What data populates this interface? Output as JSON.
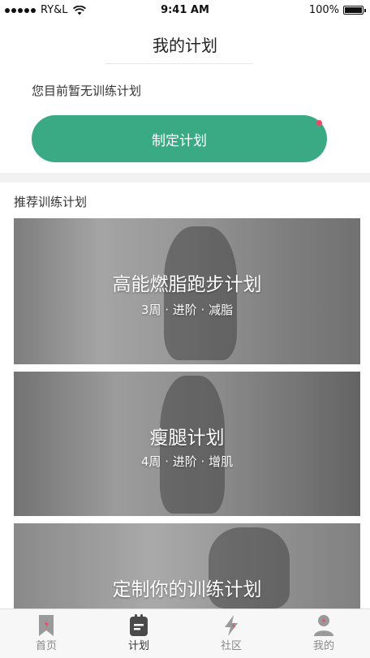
{
  "status_bar": {
    "carrier": "RY&L",
    "time": "9:41 AM",
    "battery": "100%"
  },
  "nav": {
    "title": "我的计划"
  },
  "plan": {
    "empty_text": "您目前暂无训练计划",
    "make_button": "制定计划"
  },
  "recommend": {
    "section_title": "推荐训练计划",
    "cards": [
      {
        "title": "高能燃脂跑步计划",
        "meta": "3周 · 进阶 · 减脂"
      },
      {
        "title": "瘦腿计划",
        "meta": "4周 · 进阶 · 增肌"
      },
      {
        "title": "定制你的训练计划",
        "meta": ""
      }
    ]
  },
  "tabbar": {
    "tabs": [
      {
        "label": "首页",
        "icon": "bookmark-icon",
        "active": false
      },
      {
        "label": "计划",
        "icon": "plan-icon",
        "active": true
      },
      {
        "label": "社区",
        "icon": "lightning-icon",
        "active": false
      },
      {
        "label": "我的",
        "icon": "user-icon",
        "active": false
      }
    ]
  },
  "colors": {
    "accent": "#3aaa85",
    "badge": "#f14668",
    "tab_active": "#333333",
    "tab_inactive": "#888888"
  }
}
